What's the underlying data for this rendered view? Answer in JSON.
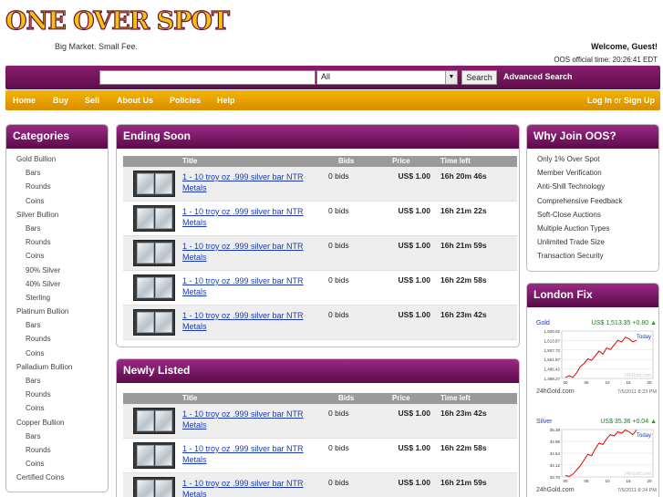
{
  "header": {
    "logo_text": "ONE OVER SPOT",
    "tagline": "Big Market. Small Fee.",
    "welcome": "Welcome, Guest!",
    "official_time": "OOS official time: 20:26:41 EDT"
  },
  "search": {
    "placeholder": "",
    "category_selected": "All",
    "search_button": "Search",
    "advanced": "Advanced Search"
  },
  "nav": {
    "items": [
      "Home",
      "Buy",
      "Sell",
      "About Us",
      "Policies",
      "Help"
    ],
    "login": "Log In",
    "or": "or",
    "signup": "Sign Up"
  },
  "categories": {
    "title": "Categories",
    "items": [
      {
        "label": "Gold Bullion",
        "level": "top"
      },
      {
        "label": "Bars",
        "level": "sub"
      },
      {
        "label": "Rounds",
        "level": "sub"
      },
      {
        "label": "Coins",
        "level": "sub"
      },
      {
        "label": "Silver Bullion",
        "level": "top"
      },
      {
        "label": "Bars",
        "level": "sub"
      },
      {
        "label": "Rounds",
        "level": "sub"
      },
      {
        "label": "Coins",
        "level": "sub"
      },
      {
        "label": "90% Silver",
        "level": "sub"
      },
      {
        "label": "40% Silver",
        "level": "sub"
      },
      {
        "label": "Sterling",
        "level": "sub"
      },
      {
        "label": "Platinum Bullion",
        "level": "top"
      },
      {
        "label": "Bars",
        "level": "sub"
      },
      {
        "label": "Rounds",
        "level": "sub"
      },
      {
        "label": "Coins",
        "level": "sub"
      },
      {
        "label": "Palladium Bullion",
        "level": "top"
      },
      {
        "label": "Bars",
        "level": "sub"
      },
      {
        "label": "Rounds",
        "level": "sub"
      },
      {
        "label": "Coins",
        "level": "sub"
      },
      {
        "label": "Copper Bullion",
        "level": "top"
      },
      {
        "label": "Bars",
        "level": "sub"
      },
      {
        "label": "Rounds",
        "level": "sub"
      },
      {
        "label": "Coins",
        "level": "sub"
      },
      {
        "label": "Certified Coins",
        "level": "top"
      }
    ]
  },
  "table_headers": {
    "title": "Title",
    "bids": "Bids",
    "price": "Price",
    "time_left": "Time left"
  },
  "ending_soon": {
    "title": "Ending Soon",
    "rows": [
      {
        "title": "1 - 10 troy oz .999 silver bar NTR Metals",
        "bids": "0 bids",
        "price": "US$ 1.00",
        "time": "16h 20m 46s"
      },
      {
        "title": "1 - 10 troy oz .999 silver bar NTR Metals",
        "bids": "0 bids",
        "price": "US$ 1.00",
        "time": "16h 21m 22s"
      },
      {
        "title": "1 - 10 troy oz .999 silver bar NTR Metals",
        "bids": "0 bids",
        "price": "US$ 1.00",
        "time": "16h 21m 59s"
      },
      {
        "title": "1 - 10 troy oz .999 silver bar NTR Metals",
        "bids": "0 bids",
        "price": "US$ 1.00",
        "time": "16h 22m 58s"
      },
      {
        "title": "1 - 10 troy oz .999 silver bar NTR Metals",
        "bids": "0 bids",
        "price": "US$ 1.00",
        "time": "16h 23m 42s"
      }
    ]
  },
  "newly_listed": {
    "title": "Newly Listed",
    "rows": [
      {
        "title": "1 - 10 troy oz .999 silver bar NTR Metals",
        "bids": "0 bids",
        "price": "US$ 1.00",
        "time": "16h 23m 42s"
      },
      {
        "title": "1 - 10 troy oz .999 silver bar NTR Metals",
        "bids": "0 bids",
        "price": "US$ 1.00",
        "time": "16h 22m 58s"
      },
      {
        "title": "1 - 10 troy oz .999 silver bar NTR Metals",
        "bids": "0 bids",
        "price": "US$ 1.00",
        "time": "16h 21m 59s"
      }
    ]
  },
  "why_join": {
    "title": "Why Join OOS?",
    "items": [
      "Only 1% Over Spot",
      "Member Verification",
      "Anti-Shill Technology",
      "Comprehensive Feedback",
      "Soft-Close Auctions",
      "Multiple Auction Types",
      "Unlimited Trade Size",
      "Transaction Security"
    ]
  },
  "london_fix": {
    "title": "London Fix",
    "gold": {
      "label": "Gold",
      "value": "US$ 1,513.35 +0.80",
      "y_ticks": [
        "1,520.02",
        "1,513.87",
        "1,507.72",
        "1,501.57",
        "1,495.42",
        "1,489.27"
      ],
      "x_ticks": [
        "00",
        "05",
        "10",
        "15",
        "20"
      ],
      "today": "Today",
      "watermark": "24hGold.com",
      "source": "24hGold.com",
      "date": "7/5/2011 8:23 PM",
      "values": [
        1490,
        1491,
        1490,
        1493,
        1497,
        1499,
        1502,
        1501,
        1504,
        1507,
        1505,
        1509,
        1508,
        1511,
        1514,
        1513,
        1516,
        1515,
        1513,
        1514
      ]
    },
    "silver": {
      "label": "Silver",
      "value": "US$ 35.36 +0.04",
      "y_ticks": [
        "35.38",
        "34.96",
        "34.54",
        "34.12",
        "33.70"
      ],
      "x_ticks": [
        "00",
        "05",
        "10",
        "15",
        "20"
      ],
      "today": "Today",
      "watermark": "24hGold.com",
      "source": "24hGold.com",
      "date": "7/5/2011 8:24 PM",
      "values": [
        33.75,
        33.72,
        33.8,
        33.95,
        34.1,
        34.3,
        34.5,
        34.45,
        34.7,
        34.9,
        34.85,
        35.05,
        35.2,
        35.15,
        35.3,
        35.25,
        35.36,
        35.3,
        35.2,
        35.36
      ]
    }
  },
  "colors": {
    "accent_purple": "#6a0d56",
    "accent_gold": "#e4a000",
    "link_blue": "#1a3bb8"
  }
}
